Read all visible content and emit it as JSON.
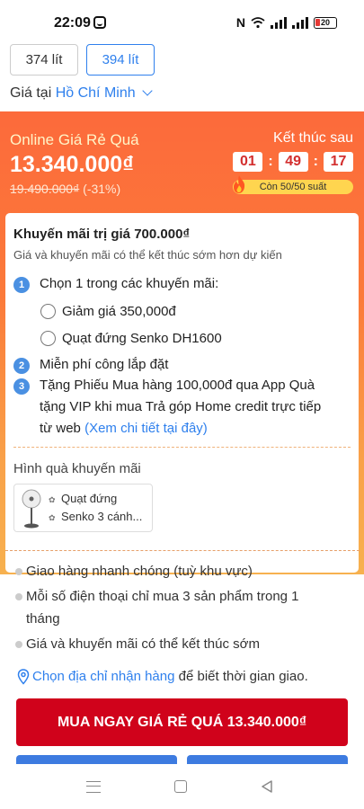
{
  "status": {
    "time": "22:09",
    "battery": "20"
  },
  "capacity_options": [
    {
      "label": "374 lít",
      "selected": false
    },
    {
      "label": "394 lít",
      "selected": true
    }
  ],
  "price_location": {
    "prefix": "Giá tại",
    "city": "Hồ Chí Minh"
  },
  "deal": {
    "label": "Online Giá Rẻ Quá",
    "price": "13.340.000₫",
    "old_price": "19.490.000₫",
    "discount": "(-31%)",
    "end_label": "Kết thúc sau",
    "timer": {
      "hours": "01",
      "minutes": "49",
      "seconds": "17"
    },
    "stock": "Còn 50/50 suất"
  },
  "promo": {
    "title": "Khuyến mãi trị giá 700.000₫",
    "subtitle": "Giá và khuyến mãi có thể kết thúc sớm hơn dự kiến",
    "items": [
      {
        "num": "1",
        "text": "Chọn 1 trong các khuyến mãi:"
      },
      {
        "num": "2",
        "text": "Miễn phí công lắp đặt"
      },
      {
        "num": "3",
        "line1": "Tặng Phiếu Mua hàng 100,000đ qua App Quà",
        "line2": "tặng VIP khi mua Trả góp Home credit trực tiếp",
        "line3": "từ web",
        "link": "(Xem chi tiết tại đây)"
      }
    ],
    "options": [
      "Giảm giá 350,000đ",
      "Quạt đứng Senko DH1600"
    ]
  },
  "gift": {
    "title": "Hình quà khuyến mãi",
    "line1": "Quạt đứng",
    "line2": "Senko 3 cánh..."
  },
  "benefits": [
    "Giao hàng nhanh chóng (tuỳ khu vực)",
    "Mỗi số điện thoại chỉ mua 3 sản phẩm trong 1",
    "tháng",
    "Giá và khuyến mãi có thể kết thúc sớm"
  ],
  "address": {
    "link": "Chọn địa chỉ nhận hàng",
    "suffix": " để biết thời gian giao."
  },
  "buy_button": "MUA NGAY GIÁ RẺ QUÁ 13.340.000₫",
  "colors": {
    "accent_blue": "#2f80ed",
    "buy_red": "#d0021b",
    "banner_orange": "#fc6a3b"
  }
}
